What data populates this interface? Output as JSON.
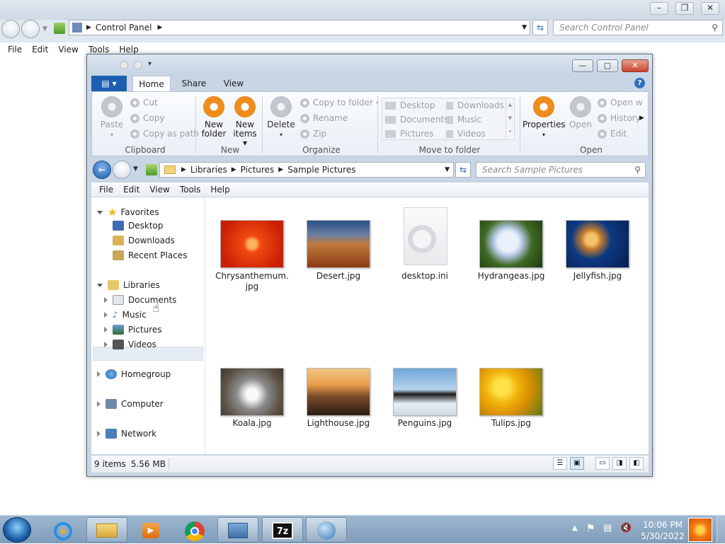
{
  "bg_window": {
    "breadcrumb": "Control Panel",
    "search_placeholder": "Search Control Panel",
    "menu": [
      "File",
      "Edit",
      "View",
      "Tools",
      "Help"
    ]
  },
  "ribbon": {
    "tabs": [
      "Home",
      "Share",
      "View"
    ],
    "active_tab": "Home",
    "clipboard": {
      "paste": "Paste",
      "cut": "Cut",
      "copy": "Copy",
      "copy_as_path": "Copy as path",
      "group": "Clipboard"
    },
    "new": {
      "new_folder": "New\nfolder",
      "new_items": "New\nitems ▾",
      "group": "New"
    },
    "organize": {
      "delete": "Delete",
      "copy_to_folder": "Copy to folder",
      "rename": "Rename",
      "zip": "Zip",
      "group": "Organize"
    },
    "move_to_folder": {
      "items": [
        "Desktop",
        "Downloads",
        "Documents",
        "Music",
        "Pictures",
        "Videos"
      ],
      "group": "Move to folder"
    },
    "open": {
      "properties": "Properties",
      "open": "Open",
      "open_with": "Open w",
      "history": "History",
      "edit": "Edit",
      "group": "Open"
    }
  },
  "nav": {
    "breadcrumb": [
      "Libraries",
      "Pictures",
      "Sample Pictures"
    ],
    "search_placeholder": "Search Sample Pictures"
  },
  "menu": [
    "File",
    "Edit",
    "View",
    "Tools",
    "Help"
  ],
  "tree": {
    "favorites": "Favorites",
    "favorites_items": [
      "Desktop",
      "Downloads",
      "Recent Places"
    ],
    "libraries": "Libraries",
    "libraries_items": [
      "Documents",
      "Music",
      "Pictures",
      "Videos"
    ],
    "homegroup": "Homegroup",
    "computer": "Computer",
    "network": "Network"
  },
  "files": [
    {
      "name": "Chrysanthemum.\njpg"
    },
    {
      "name": "Desert.jpg"
    },
    {
      "name": "desktop.ini"
    },
    {
      "name": "Hydrangeas.jpg"
    },
    {
      "name": "Jellyfish.jpg"
    },
    {
      "name": "Koala.jpg"
    },
    {
      "name": "Lighthouse.jpg"
    },
    {
      "name": "Penguins.jpg"
    },
    {
      "name": "Tulips.jpg"
    }
  ],
  "status": {
    "count": "9 items",
    "size": "5.56 MB"
  },
  "taskbar": {
    "time": "10:06 PM",
    "date": "5/30/2022"
  }
}
